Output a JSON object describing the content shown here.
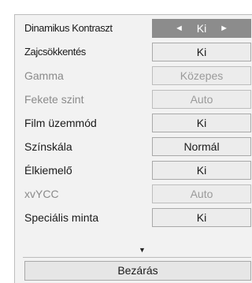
{
  "settings": [
    {
      "label": "Dinamikus Kontraszt",
      "value": "Ki",
      "state": "selected",
      "arrow_left": "◄",
      "arrow_right": "►"
    },
    {
      "label": "Zajcsökkentés",
      "value": "Ki",
      "state": "normal"
    },
    {
      "label": "Gamma",
      "value": "Közepes",
      "state": "disabled"
    },
    {
      "label": "Fekete szint",
      "value": "Auto",
      "state": "disabled"
    },
    {
      "label": "Film üzemmód",
      "value": "Ki",
      "state": "normal"
    },
    {
      "label": "Színskála",
      "value": "Normál",
      "state": "normal"
    },
    {
      "label": "Élkiemelő",
      "value": "Ki",
      "state": "normal"
    },
    {
      "label": "xvYCC",
      "value": "Auto",
      "state": "disabled"
    },
    {
      "label": "Speciális minta",
      "value": "Ki",
      "state": "normal"
    }
  ],
  "scroll_indicator": "▼",
  "close_label": "Bezárás",
  "colors": {
    "panel_background": "#f2f2f2",
    "selected_background": "#8c8c8c",
    "disabled_text": "#8a8a8a"
  }
}
